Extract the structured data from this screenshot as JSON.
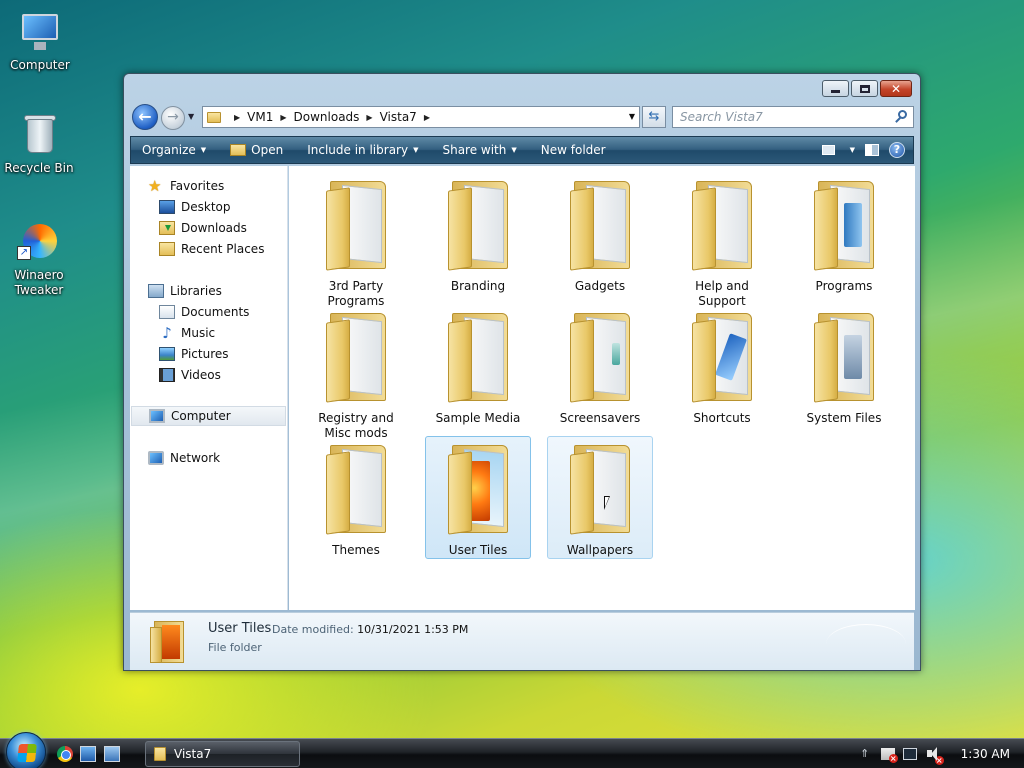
{
  "desktop": {
    "icons": [
      {
        "label": "Computer",
        "icon": "computer-icon"
      },
      {
        "label": "Recycle Bin",
        "icon": "recycle-bin-icon"
      },
      {
        "label": "Winaero Tweaker",
        "icon": "winaero-tweaker-icon"
      }
    ]
  },
  "explorer": {
    "address": {
      "crumbs": [
        "VM1",
        "Downloads",
        "Vista7"
      ]
    },
    "search": {
      "placeholder": "Search Vista7"
    },
    "toolbar": {
      "organize": "Organize",
      "open": "Open",
      "include": "Include in library",
      "share": "Share with",
      "new_folder": "New folder"
    },
    "nav": {
      "favorites": "Favorites",
      "desktop": "Desktop",
      "downloads": "Downloads",
      "recent": "Recent Places",
      "libraries": "Libraries",
      "documents": "Documents",
      "music": "Music",
      "pictures": "Pictures",
      "videos": "Videos",
      "computer": "Computer",
      "network": "Network"
    },
    "folders": [
      {
        "name": "3rd Party Programs"
      },
      {
        "name": "Branding"
      },
      {
        "name": "Gadgets"
      },
      {
        "name": "Help and Support"
      },
      {
        "name": "Programs"
      },
      {
        "name": "Registry and Misc mods"
      },
      {
        "name": "Sample Media"
      },
      {
        "name": "Screensavers"
      },
      {
        "name": "Shortcuts"
      },
      {
        "name": "System Files"
      },
      {
        "name": "Themes"
      },
      {
        "name": "User Tiles",
        "state": "selected"
      },
      {
        "name": "Wallpapers",
        "state": "hover"
      }
    ],
    "details": {
      "name": "User Tiles",
      "modified_label": "Date modified:",
      "modified_value": "10/31/2021 1:53 PM",
      "type": "File folder"
    }
  },
  "taskbar": {
    "task_label": "Vista7",
    "clock": "1:30 AM"
  },
  "colors": {
    "command_bar": "#2c5878",
    "selection": "#cfe6f7",
    "taskbar": "#14171a"
  }
}
